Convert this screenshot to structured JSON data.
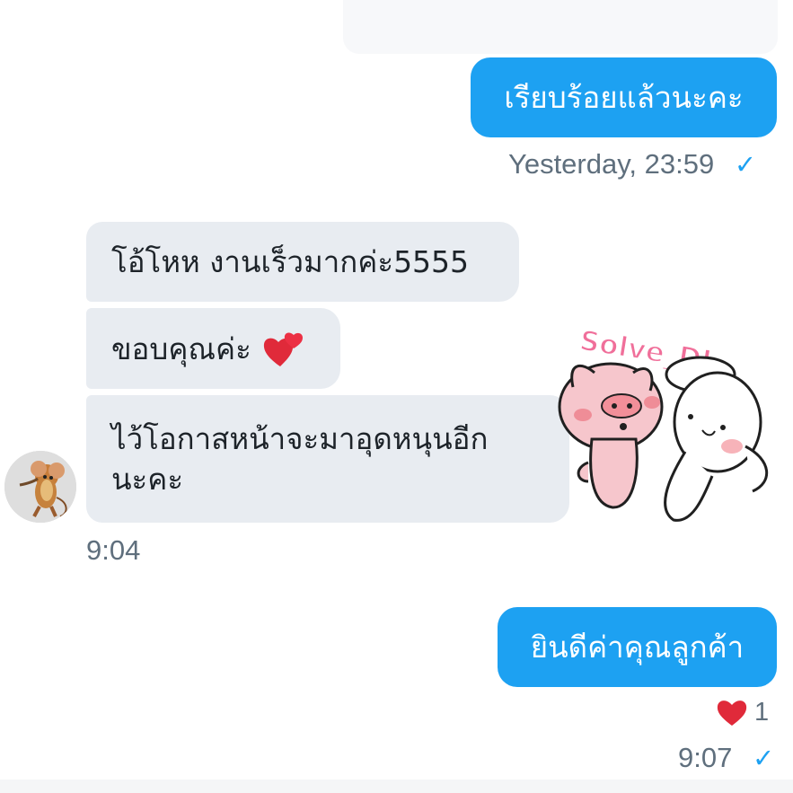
{
  "messages": {
    "outgoing_1": "เรียบร้อยแล้วนะคะ",
    "outgoing_1_time": "Yesterday, 23:59",
    "incoming_1": "โอ้โหห งานเร็วมากค่ะ5555",
    "incoming_2": "ขอบคุณค่ะ",
    "incoming_3_line_1": "ไว้โอกาสหน้าจะมาอุดหนุนอีก",
    "incoming_3_line_2": "นะคะ",
    "incoming_time": "9:04",
    "outgoing_2": "ยินดีค่าคุณลูกค้า",
    "reaction_count": "1",
    "outgoing_2_time": "9:07",
    "read_check": "✓"
  },
  "sticker": {
    "text": "Solve_DI"
  },
  "icons": {
    "avatar": "mouse-avatar",
    "sticker": "pig-bunny-sticker",
    "emoji": "two-hearts-icon",
    "reaction": "heart-reaction-icon",
    "status": "check-icon"
  },
  "colors": {
    "outgoing": "#1da1f2",
    "incoming": "#e8ecf1",
    "heart": "#e02a3a",
    "time": "#5f6f7d"
  }
}
